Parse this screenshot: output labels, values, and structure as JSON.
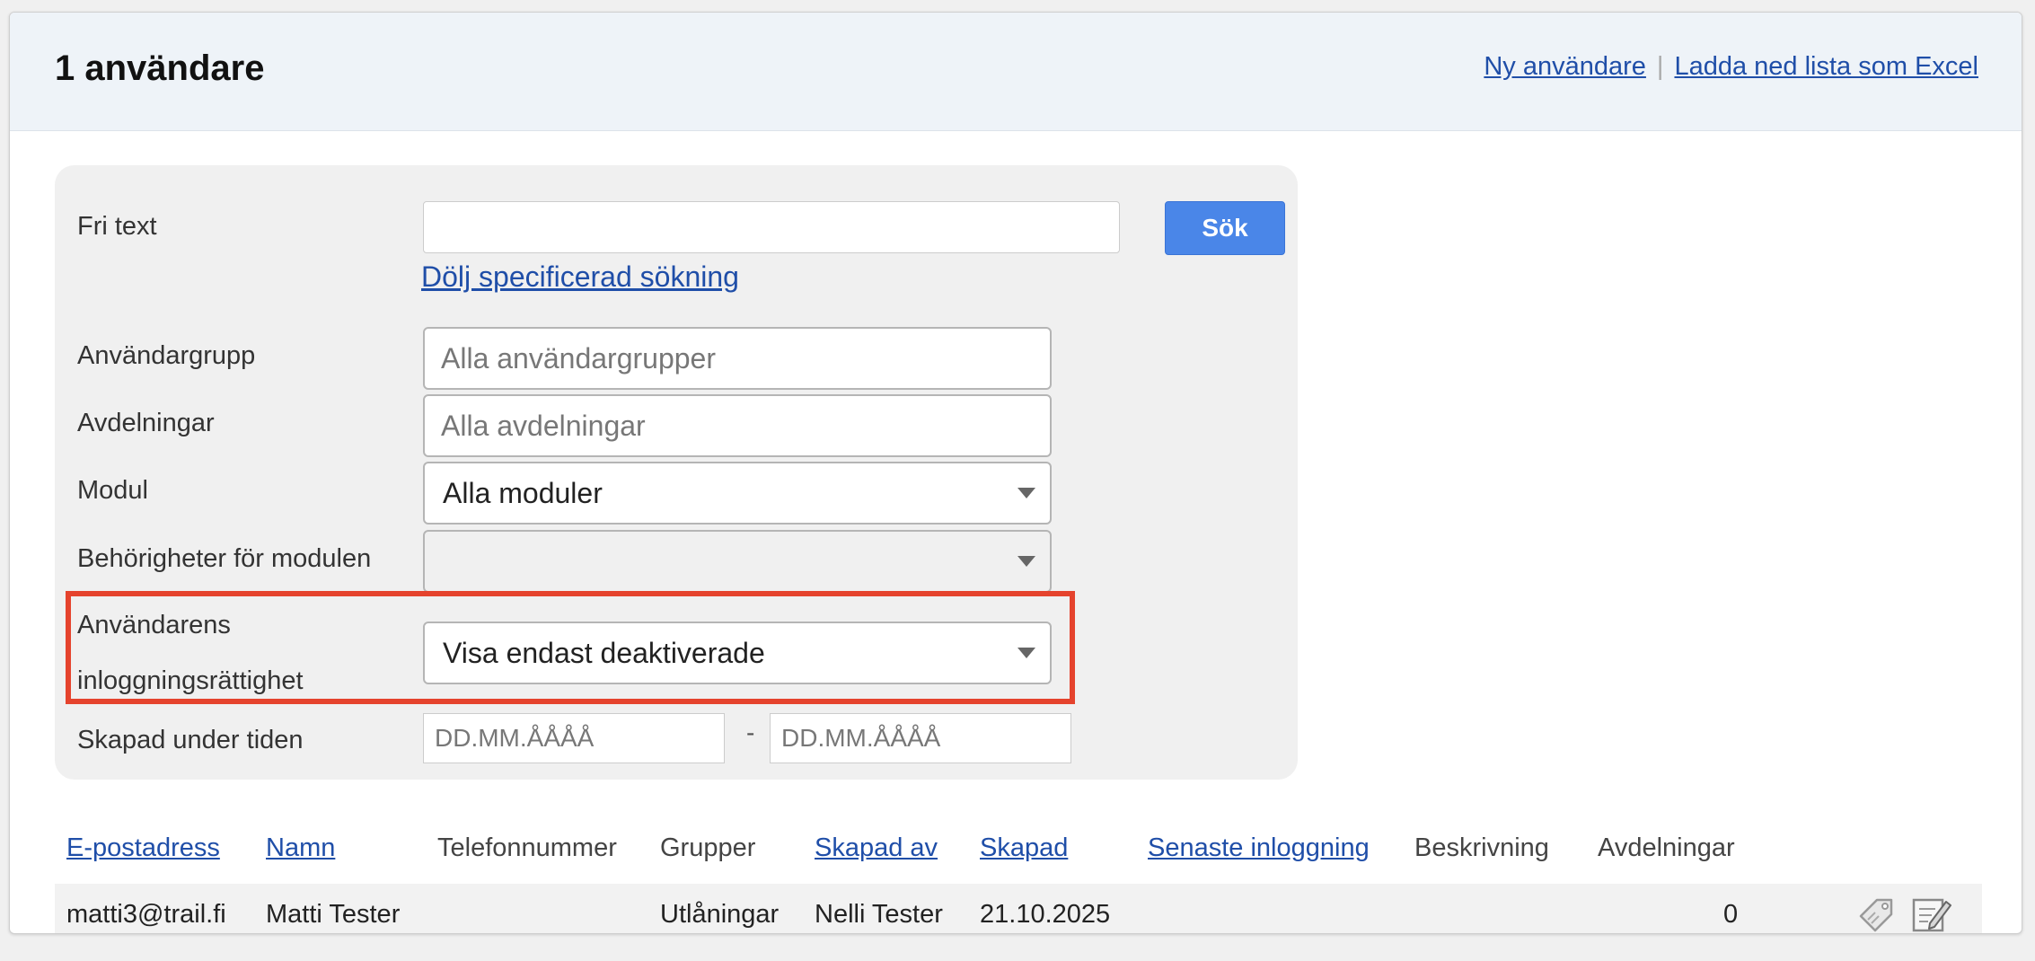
{
  "header": {
    "title": "1 användare",
    "new_user_link": "Ny användare",
    "separator": "|",
    "download_link": "Ladda ned lista som Excel"
  },
  "search": {
    "free_text_label": "Fri text",
    "free_text_value": "",
    "search_button": "Sök",
    "toggle_link": "Dölj specificerad sökning",
    "user_group_label": "Användargrupp",
    "user_group_placeholder": "Alla användargrupper",
    "departments_label": "Avdelningar",
    "departments_placeholder": "Alla avdelningar",
    "module_label": "Modul",
    "module_value": "Alla moduler",
    "permissions_label": "Behörigheter för modulen",
    "permissions_value": "",
    "login_right_label_line1": "Användarens",
    "login_right_label_line2": "inloggningsrättighet",
    "login_right_value": "Visa endast deaktiverade",
    "created_label": "Skapad under tiden",
    "date_from_placeholder": "DD.MM.ÅÅÅÅ",
    "date_dash": "-",
    "date_to_placeholder": "DD.MM.ÅÅÅÅ"
  },
  "table": {
    "columns": [
      "E-postadress",
      "Namn",
      "Telefonnummer",
      "Grupper",
      "Skapad av",
      "Skapad",
      "Senaste inloggning",
      "Beskrivning",
      "Avdelningar"
    ],
    "rows": [
      {
        "email": "matti3@trail.fi",
        "name": "Matti Tester",
        "phone": "",
        "groups": "Utlåningar",
        "created_by": "Nelli Tester",
        "created": "21.10.2025",
        "last_login": "",
        "description": "",
        "departments": "0"
      }
    ]
  },
  "colors": {
    "highlight": "#e5432d",
    "button": "#4a86e8",
    "link": "#1f4ea8"
  },
  "icons": [
    "tag-icon",
    "edit-icon"
  ]
}
